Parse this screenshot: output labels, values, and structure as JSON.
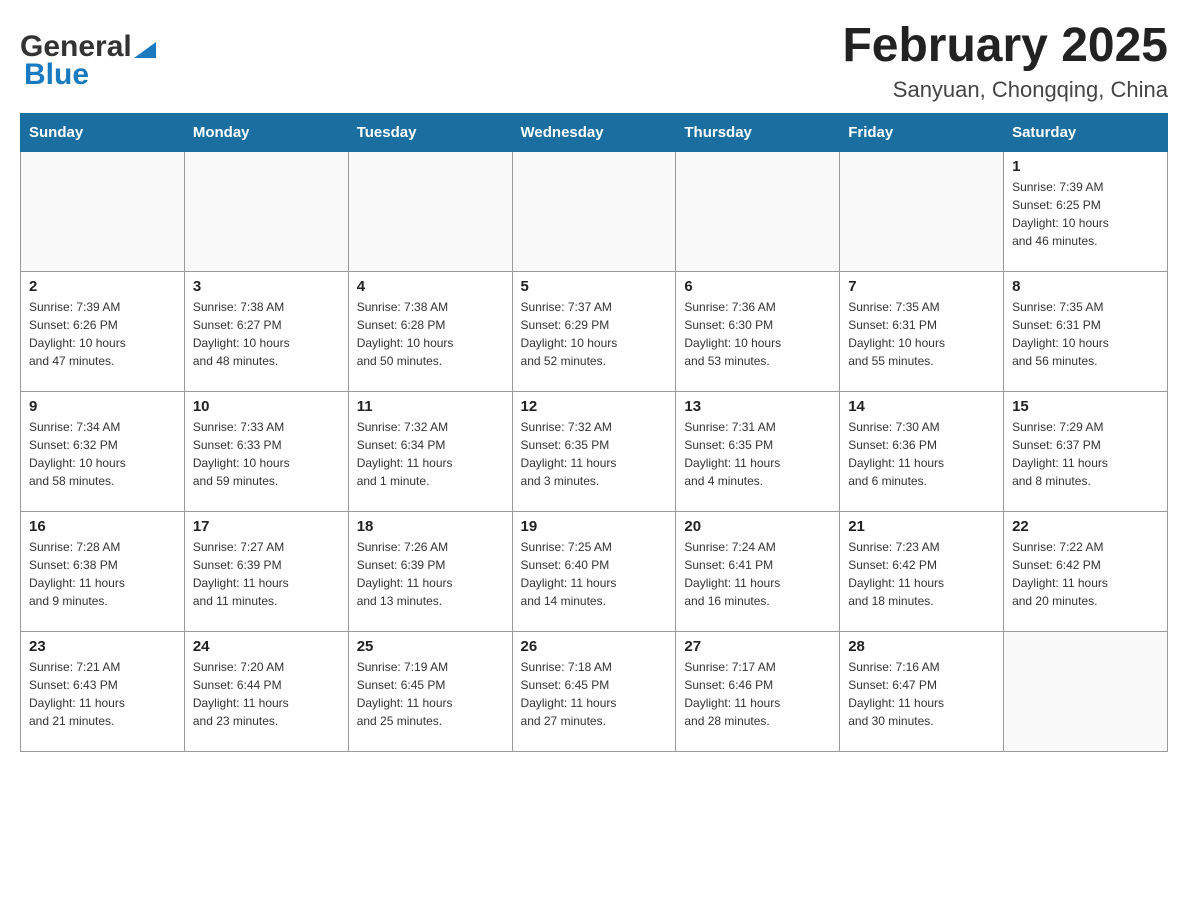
{
  "header": {
    "logo_general": "General",
    "logo_blue": "Blue",
    "title": "February 2025",
    "subtitle": "Sanyuan, Chongqing, China"
  },
  "days_of_week": [
    "Sunday",
    "Monday",
    "Tuesday",
    "Wednesday",
    "Thursday",
    "Friday",
    "Saturday"
  ],
  "weeks": [
    [
      {
        "day": "",
        "info": ""
      },
      {
        "day": "",
        "info": ""
      },
      {
        "day": "",
        "info": ""
      },
      {
        "day": "",
        "info": ""
      },
      {
        "day": "",
        "info": ""
      },
      {
        "day": "",
        "info": ""
      },
      {
        "day": "1",
        "info": "Sunrise: 7:39 AM\nSunset: 6:25 PM\nDaylight: 10 hours\nand 46 minutes."
      }
    ],
    [
      {
        "day": "2",
        "info": "Sunrise: 7:39 AM\nSunset: 6:26 PM\nDaylight: 10 hours\nand 47 minutes."
      },
      {
        "day": "3",
        "info": "Sunrise: 7:38 AM\nSunset: 6:27 PM\nDaylight: 10 hours\nand 48 minutes."
      },
      {
        "day": "4",
        "info": "Sunrise: 7:38 AM\nSunset: 6:28 PM\nDaylight: 10 hours\nand 50 minutes."
      },
      {
        "day": "5",
        "info": "Sunrise: 7:37 AM\nSunset: 6:29 PM\nDaylight: 10 hours\nand 52 minutes."
      },
      {
        "day": "6",
        "info": "Sunrise: 7:36 AM\nSunset: 6:30 PM\nDaylight: 10 hours\nand 53 minutes."
      },
      {
        "day": "7",
        "info": "Sunrise: 7:35 AM\nSunset: 6:31 PM\nDaylight: 10 hours\nand 55 minutes."
      },
      {
        "day": "8",
        "info": "Sunrise: 7:35 AM\nSunset: 6:31 PM\nDaylight: 10 hours\nand 56 minutes."
      }
    ],
    [
      {
        "day": "9",
        "info": "Sunrise: 7:34 AM\nSunset: 6:32 PM\nDaylight: 10 hours\nand 58 minutes."
      },
      {
        "day": "10",
        "info": "Sunrise: 7:33 AM\nSunset: 6:33 PM\nDaylight: 10 hours\nand 59 minutes."
      },
      {
        "day": "11",
        "info": "Sunrise: 7:32 AM\nSunset: 6:34 PM\nDaylight: 11 hours\nand 1 minute."
      },
      {
        "day": "12",
        "info": "Sunrise: 7:32 AM\nSunset: 6:35 PM\nDaylight: 11 hours\nand 3 minutes."
      },
      {
        "day": "13",
        "info": "Sunrise: 7:31 AM\nSunset: 6:35 PM\nDaylight: 11 hours\nand 4 minutes."
      },
      {
        "day": "14",
        "info": "Sunrise: 7:30 AM\nSunset: 6:36 PM\nDaylight: 11 hours\nand 6 minutes."
      },
      {
        "day": "15",
        "info": "Sunrise: 7:29 AM\nSunset: 6:37 PM\nDaylight: 11 hours\nand 8 minutes."
      }
    ],
    [
      {
        "day": "16",
        "info": "Sunrise: 7:28 AM\nSunset: 6:38 PM\nDaylight: 11 hours\nand 9 minutes."
      },
      {
        "day": "17",
        "info": "Sunrise: 7:27 AM\nSunset: 6:39 PM\nDaylight: 11 hours\nand 11 minutes."
      },
      {
        "day": "18",
        "info": "Sunrise: 7:26 AM\nSunset: 6:39 PM\nDaylight: 11 hours\nand 13 minutes."
      },
      {
        "day": "19",
        "info": "Sunrise: 7:25 AM\nSunset: 6:40 PM\nDaylight: 11 hours\nand 14 minutes."
      },
      {
        "day": "20",
        "info": "Sunrise: 7:24 AM\nSunset: 6:41 PM\nDaylight: 11 hours\nand 16 minutes."
      },
      {
        "day": "21",
        "info": "Sunrise: 7:23 AM\nSunset: 6:42 PM\nDaylight: 11 hours\nand 18 minutes."
      },
      {
        "day": "22",
        "info": "Sunrise: 7:22 AM\nSunset: 6:42 PM\nDaylight: 11 hours\nand 20 minutes."
      }
    ],
    [
      {
        "day": "23",
        "info": "Sunrise: 7:21 AM\nSunset: 6:43 PM\nDaylight: 11 hours\nand 21 minutes."
      },
      {
        "day": "24",
        "info": "Sunrise: 7:20 AM\nSunset: 6:44 PM\nDaylight: 11 hours\nand 23 minutes."
      },
      {
        "day": "25",
        "info": "Sunrise: 7:19 AM\nSunset: 6:45 PM\nDaylight: 11 hours\nand 25 minutes."
      },
      {
        "day": "26",
        "info": "Sunrise: 7:18 AM\nSunset: 6:45 PM\nDaylight: 11 hours\nand 27 minutes."
      },
      {
        "day": "27",
        "info": "Sunrise: 7:17 AM\nSunset: 6:46 PM\nDaylight: 11 hours\nand 28 minutes."
      },
      {
        "day": "28",
        "info": "Sunrise: 7:16 AM\nSunset: 6:47 PM\nDaylight: 11 hours\nand 30 minutes."
      },
      {
        "day": "",
        "info": ""
      }
    ]
  ]
}
